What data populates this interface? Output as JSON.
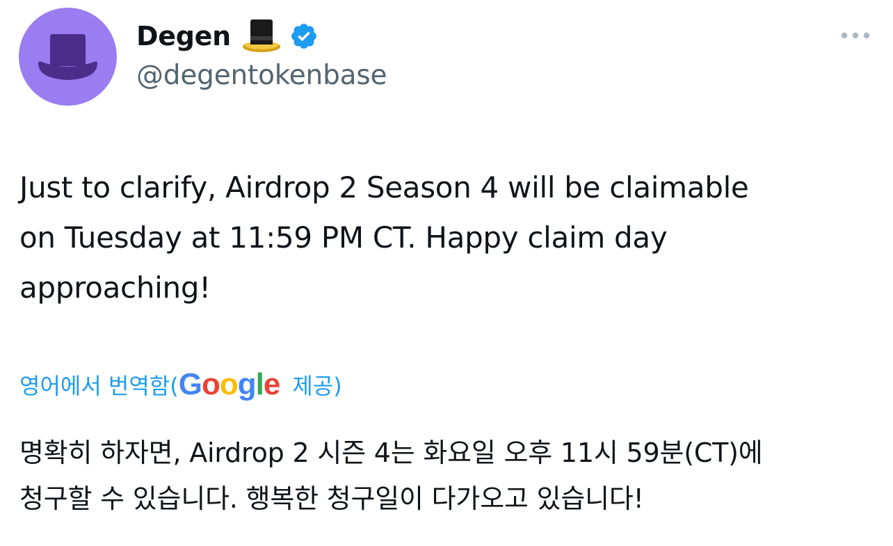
{
  "author": {
    "name": "Degen",
    "handle": "@degentokenbase",
    "avatar_icon": "tophat-avatar-icon",
    "name_emoji_icon": "tophat-icon",
    "verified_icon": "verified-badge-icon",
    "avatar_color": "#9a7df1",
    "verified_color": "#1d9bf0"
  },
  "menu": {
    "icon": "more-horizontal-icon"
  },
  "tweet": {
    "text_line1": "Just to clarify, Airdrop 2 Season 4 will be claimable",
    "text_line2": "on Tuesday at 11:59 PM CT. Happy claim day",
    "text_line3": "approaching!"
  },
  "translation": {
    "prefix": "영어에서 번역함(",
    "google_G": "G",
    "google_o1": "o",
    "google_o2": "o",
    "google_g": "g",
    "google_l": "l",
    "google_e": "e",
    "suffix": "제공)",
    "link_color": "#1d9bf0",
    "text_line1": "명확히 하자면, Airdrop 2 시즌 4는 화요일 오후 11시 59분(CT)에",
    "text_line2": "청구할 수 있습니다. 행복한 청구일이 다가오고 있습니다!"
  }
}
